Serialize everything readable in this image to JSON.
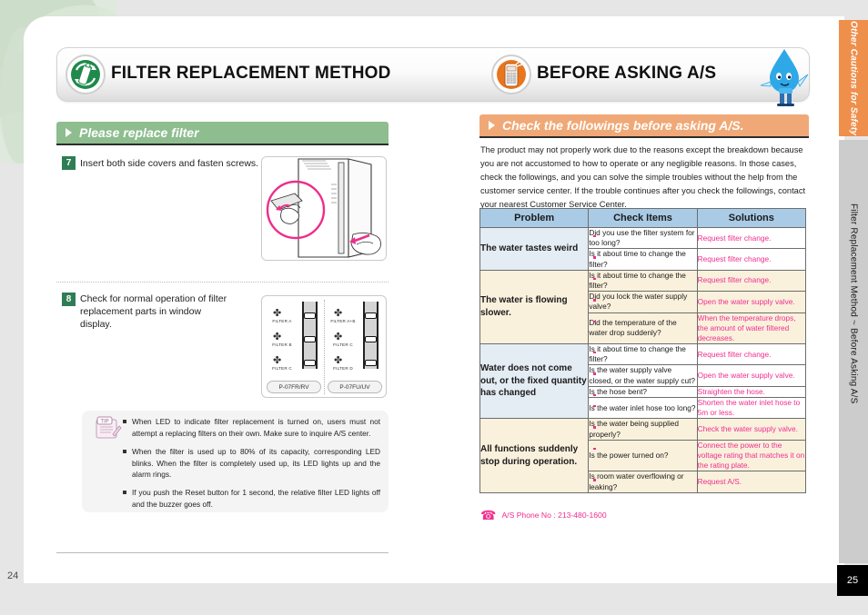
{
  "document": {
    "page_left": "24",
    "page_right": "25"
  },
  "side_tabs": [
    {
      "label": "Other Cautions for Safety",
      "color": "#ef8f4c"
    },
    {
      "label": "Filter Replacement Method ~ Before Asking A/S",
      "color": "#cccccc"
    }
  ],
  "banners": {
    "left": {
      "title": "FILTER REPLACEMENT METHOD",
      "icon": "filter-recycle-icon"
    },
    "right": {
      "title": "BEFORE ASKING A/S",
      "icon": "telephone-icon"
    },
    "mascot": "water-drop-mascot"
  },
  "left_column": {
    "section_title": "Please replace filter",
    "steps": [
      {
        "num": "7",
        "text": "Insert both side covers and fasten screws."
      },
      {
        "num": "8",
        "text": "Check for normal operation of filter replacement parts in window display."
      }
    ],
    "display_panels": [
      {
        "model": "P-07FR/RV",
        "filters": [
          "FILTER A",
          "FILTER B",
          "FILTER C"
        ]
      },
      {
        "model": "P-07FU/UV",
        "filters": [
          "FILTER A+B",
          "FILTER C",
          "FILTER D"
        ]
      }
    ],
    "tip": {
      "badge": "TIP",
      "items": [
        "When LED to indicate filter replacement is turned on, users must not attempt a replacing filters on their own. Make sure to inquire A/S center.",
        "When the filter is used up to 80% of its capacity, corresponding LED blinks. When the filter is completely used up, its LED lights up and the alarm rings.",
        "If you push the Reset button for 1 second, the relative filter LED lights off and the buzzer goes off."
      ]
    }
  },
  "right_column": {
    "section_title": "Check the followings before asking A/S.",
    "intro": "The product may not properly work due to the reasons except the breakdown because you are not accustomed to how to operate or any negligible reasons. In those cases, check the followings, and you can solve the simple troubles without the help from the customer service center. If the trouble continues after you check the followings, contact your nearest Customer Service Center.",
    "table": {
      "headers": [
        "Problem",
        "Check Items",
        "Solutions"
      ],
      "groups": [
        {
          "problem": "The water tastes weird",
          "shade": "blue",
          "rows": [
            {
              "check": "Did you use the filter system for too long?",
              "solution": "Request filter change."
            },
            {
              "check": "Is it about time to change the filter?",
              "solution": "Request filter change."
            }
          ]
        },
        {
          "problem": "The water is flowing slower.",
          "shade": "cream",
          "rows": [
            {
              "check": "Is it about time to change the filter?",
              "solution": "Request filter change."
            },
            {
              "check": "Did you lock the water supply valve?",
              "solution": "Open the water supply valve."
            },
            {
              "check": "Did the temperature of the water drop suddenly?",
              "solution": "When the temperature drops, the amount of water filtered decreases."
            }
          ]
        },
        {
          "problem": "Water does not come out, or the fixed quantity has changed",
          "shade": "blue",
          "rows": [
            {
              "check": "Is it about time to change the filter?",
              "solution": "Request filter change."
            },
            {
              "check": "Is the water supply valve closed, or the water supply cut?",
              "solution": "Open the water supply valve."
            },
            {
              "check": "Is the hose bent?",
              "solution": "Straighten the hose."
            },
            {
              "check": "Is the water inlet hose too long?",
              "solution": "Shorten the water inlet hose to 5m or less."
            }
          ]
        },
        {
          "problem": "All functions suddenly stop during operation.",
          "shade": "cream",
          "rows": [
            {
              "check": "Is the water being supplied properly?",
              "solution": "Check the water supply valve."
            },
            {
              "check": "Is the power turned on?",
              "solution": "Connect the power to the voltage rating that matches it on the rating plate."
            },
            {
              "check": "Is room water overflowing or leaking?",
              "solution": "Request A/S."
            }
          ]
        }
      ]
    },
    "phone": {
      "icon": "telephone-icon",
      "text": "A/S Phone No : 213-480-1600"
    }
  },
  "colors": {
    "green_bar": "#8ebd8f",
    "orange_bar": "#f0a876",
    "table_header": "#aacbe5",
    "solution_text": "#ef2e8e",
    "step_badge": "#2f7d55"
  }
}
